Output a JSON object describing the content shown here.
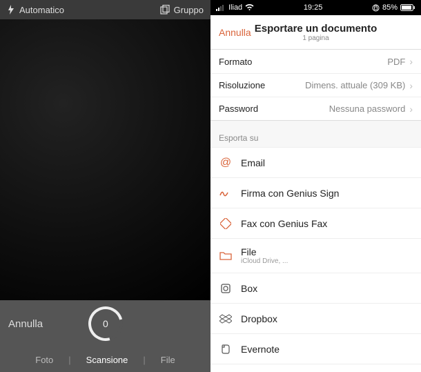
{
  "left": {
    "flash_mode": "Automatico",
    "group_label": "Gruppo",
    "cancel": "Annulla",
    "shutter_count": "0",
    "tabs": {
      "photo": "Foto",
      "scan": "Scansione",
      "file": "File"
    }
  },
  "right": {
    "status": {
      "carrier": "Iliad",
      "time": "19:25",
      "battery": "85%"
    },
    "header": {
      "cancel": "Annulla",
      "title": "Esportare un documento",
      "subtitle": "1 pagina"
    },
    "settings": [
      {
        "label": "Formato",
        "value": "PDF"
      },
      {
        "label": "Risoluzione",
        "value": "Dimens. attuale (309 KB)"
      },
      {
        "label": "Password",
        "value": "Nessuna password"
      }
    ],
    "export_header": "Esporta su",
    "export_items": [
      {
        "label": "Email"
      },
      {
        "label": "Firma con Genius Sign"
      },
      {
        "label": "Fax con Genius Fax"
      },
      {
        "label": "File",
        "sub": "iCloud Drive, ..."
      },
      {
        "label": "Box"
      },
      {
        "label": "Dropbox"
      },
      {
        "label": "Evernote"
      }
    ]
  }
}
